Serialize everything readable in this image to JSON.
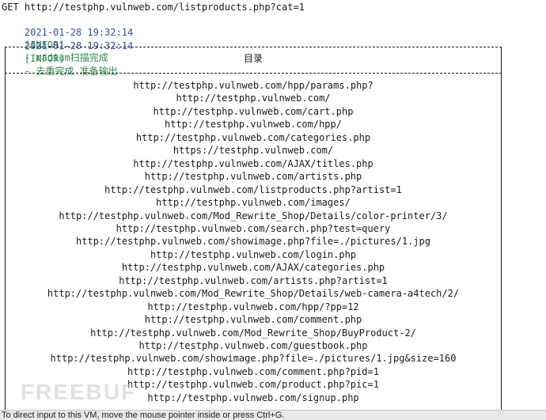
{
  "command": "GET http://testphp.vulnweb.com/listproducts.php?cat=1",
  "logs": [
    {
      "timestamp": "2021-01-28 19:32:14",
      "level": "[INFOR]",
      "message": "- radium扫描完成"
    },
    {
      "timestamp": "2021-01-28 19:32:14",
      "level": "[INFOR]",
      "message": "- 去重完成 准备输出"
    }
  ],
  "table": {
    "header": "目录",
    "rows": [
      "http://testphp.vulnweb.com/hpp/params.php?",
      "http://testphp.vulnweb.com/",
      "http://testphp.vulnweb.com/cart.php",
      "http://testphp.vulnweb.com/hpp/",
      "http://testphp.vulnweb.com/categories.php",
      "https://testphp.vulnweb.com/",
      "http://testphp.vulnweb.com/AJAX/titles.php",
      "http://testphp.vulnweb.com/artists.php",
      "http://testphp.vulnweb.com/listproducts.php?artist=1",
      "http://testphp.vulnweb.com/images/",
      "http://testphp.vulnweb.com/Mod_Rewrite_Shop/Details/color-printer/3/",
      "http://testphp.vulnweb.com/search.php?test=query",
      "http://testphp.vulnweb.com/showimage.php?file=./pictures/1.jpg",
      "http://testphp.vulnweb.com/login.php",
      "http://testphp.vulnweb.com/AJAX/categories.php",
      "http://testphp.vulnweb.com/artists.php?artist=1",
      "http://testphp.vulnweb.com/Mod_Rewrite_Shop/Details/web-camera-a4tech/2/",
      "http://testphp.vulnweb.com/hpp/?pp=12",
      "http://testphp.vulnweb.com/comment.php",
      "http://testphp.vulnweb.com/Mod_Rewrite_Shop/BuyProduct-2/",
      "http://testphp.vulnweb.com/guestbook.php",
      "http://testphp.vulnweb.com/showimage.php?file=./pictures/1.jpg&size=160",
      "http://testphp.vulnweb.com/comment.php?pid=1",
      "http://testphp.vulnweb.com/product.php?pic=1",
      "http://testphp.vulnweb.com/signup.php"
    ]
  },
  "watermark": "FREEBUF",
  "status_bar": "To direct input to this VM, move the mouse pointer inside or press Ctrl+G."
}
